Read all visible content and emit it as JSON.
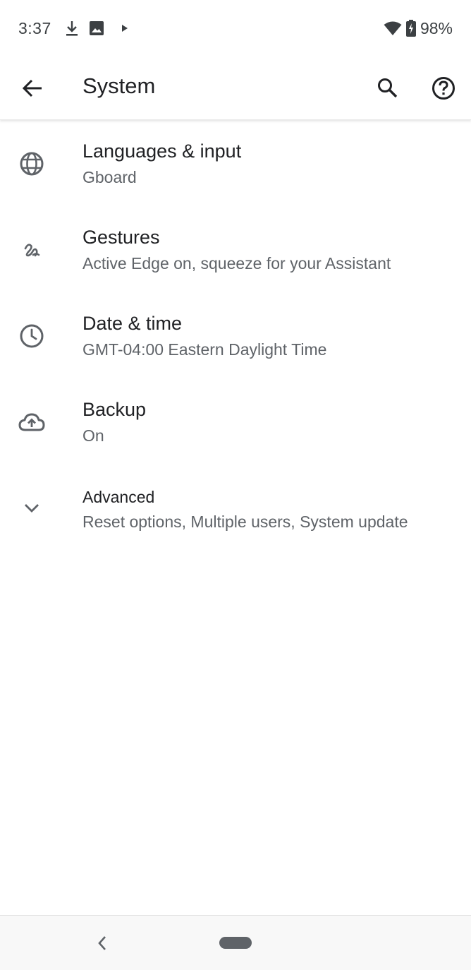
{
  "status_bar": {
    "time": "3:37",
    "battery_percent": "98%",
    "icons": [
      "download-icon",
      "image-icon",
      "play-icon",
      "wifi-icon",
      "battery-charging-icon"
    ]
  },
  "app_bar": {
    "title": "System",
    "back_icon": "arrow-back-icon",
    "search_icon": "search-icon",
    "help_icon": "help-icon"
  },
  "settings": [
    {
      "icon": "globe-icon",
      "title": "Languages & input",
      "summary": "Gboard"
    },
    {
      "icon": "gesture-icon",
      "title": "Gestures",
      "summary": "Active Edge on, squeeze for your Assistant"
    },
    {
      "icon": "clock-icon",
      "title": "Date & time",
      "summary": "GMT-04:00 Eastern Daylight Time"
    },
    {
      "icon": "cloud-upload-icon",
      "title": "Backup",
      "summary": "On"
    },
    {
      "icon": "chevron-down-icon",
      "title": "Advanced",
      "summary": "Reset options, Multiple users, System update"
    }
  ],
  "nav_bar": {
    "back_icon": "nav-back-icon",
    "home_pill": "home-pill"
  },
  "colors": {
    "text_primary": "#202124",
    "text_secondary": "#5f6368",
    "icon": "#5f6368",
    "background": "#ffffff",
    "nav_background": "#f8f8f8"
  }
}
